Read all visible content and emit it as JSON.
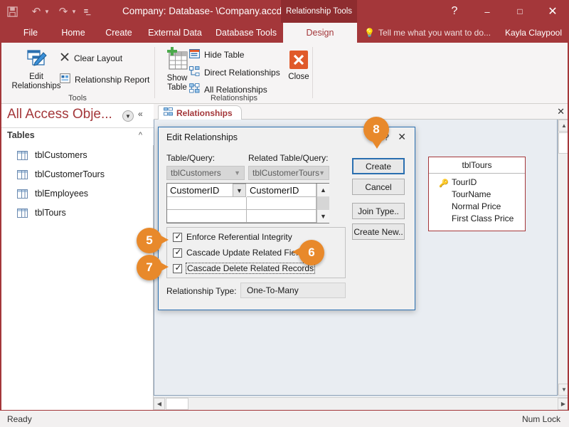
{
  "titlebar": {
    "document_title": "Company: Database- \\Company.accdb...",
    "contextual_tab_group": "Relationship Tools",
    "quick_access": [
      {
        "name": "save-icon",
        "glyph": "Ὃe"
      },
      {
        "name": "undo-icon",
        "glyph": "↶"
      },
      {
        "name": "redo-icon",
        "glyph": "↷"
      },
      {
        "name": "customize-qat-icon",
        "glyph": "☰"
      }
    ],
    "window_controls": {
      "help": "?",
      "minimize": "–",
      "maximize": "□",
      "close": "✕"
    }
  },
  "ribbon": {
    "tabs": [
      {
        "label": "File",
        "active": false
      },
      {
        "label": "Home",
        "active": false
      },
      {
        "label": "Create",
        "active": false
      },
      {
        "label": "External Data",
        "active": false
      },
      {
        "label": "Database Tools",
        "active": false
      },
      {
        "label": "Design",
        "active": true
      }
    ],
    "tell_me": "Tell me what you want to do...",
    "user_name": "Kayla Claypool",
    "groups": [
      {
        "name": "Tools",
        "label": "Tools",
        "big_buttons": [
          {
            "label_line1": "Edit",
            "label_line2": "Relationships",
            "icon": "edit-relationships-icon"
          }
        ],
        "small_buttons": [
          {
            "label": "Clear Layout",
            "icon": "clear-layout-icon"
          },
          {
            "label": "Relationship Report",
            "icon": "relationship-report-icon"
          }
        ]
      },
      {
        "name": "Relationships",
        "label": "Relationships",
        "big_buttons": [
          {
            "label_line1": "Show",
            "label_line2": "Table",
            "icon": "show-table-icon"
          },
          {
            "label_line1": "Close",
            "label_line2": "",
            "icon": "close-icon"
          }
        ],
        "small_buttons": [
          {
            "label": "Hide Table",
            "icon": "hide-table-icon"
          },
          {
            "label": "Direct Relationships",
            "icon": "direct-relationships-icon"
          },
          {
            "label": "All Relationships",
            "icon": "all-relationships-icon"
          }
        ]
      }
    ]
  },
  "nav_pane": {
    "title": "All Access Obje...",
    "group_label": "Tables",
    "items": [
      {
        "label": "tblCustomers"
      },
      {
        "label": "tblCustomerTours"
      },
      {
        "label": "tblEmployees"
      },
      {
        "label": "tblTours"
      }
    ]
  },
  "document": {
    "tab_label": "Relationships",
    "table_boxes": [
      {
        "title": "tblTours",
        "fields": [
          {
            "name": "TourID",
            "is_key": true
          },
          {
            "name": "TourName",
            "is_key": false
          },
          {
            "name": "Normal Price",
            "is_key": false
          },
          {
            "name": "First Class Price",
            "is_key": false
          }
        ]
      }
    ]
  },
  "dialog": {
    "title": "Edit Relationships",
    "help_glyph": "?",
    "close_glyph": "✕",
    "left_label": "Table/Query:",
    "right_label": "Related Table/Query:",
    "left_table": "tblCustomers",
    "right_table": "tblCustomerTours",
    "grid_rows": [
      {
        "left_field": "CustomerID",
        "right_field": "CustomerID"
      },
      {
        "left_field": "",
        "right_field": ""
      },
      {
        "left_field": "",
        "right_field": ""
      }
    ],
    "checkboxes": [
      {
        "label": "Enforce Referential Integrity",
        "checked": true,
        "focused": false
      },
      {
        "label": "Cascade Update Related Fields",
        "checked": true,
        "focused": false
      },
      {
        "label": "Cascade Delete Related Records",
        "checked": true,
        "focused": true
      }
    ],
    "relationship_type_label": "Relationship Type:",
    "relationship_type_value": "One-To-Many",
    "buttons": [
      {
        "label": "Create",
        "primary": true
      },
      {
        "label": "Cancel",
        "primary": false
      },
      {
        "label": "Join Type..",
        "primary": false
      },
      {
        "label": "Create New..",
        "primary": false
      }
    ]
  },
  "callouts": [
    {
      "number": "5",
      "direction": "right"
    },
    {
      "number": "6",
      "direction": "left"
    },
    {
      "number": "7",
      "direction": "right"
    },
    {
      "number": "8",
      "direction": "down"
    }
  ],
  "statusbar": {
    "left": "Ready",
    "right": "Num Lock"
  },
  "colors": {
    "accent": "#a4373a",
    "contextual": "#8e2c2f",
    "callout": "#e8892b",
    "focus_blue": "#2a6fb0"
  }
}
